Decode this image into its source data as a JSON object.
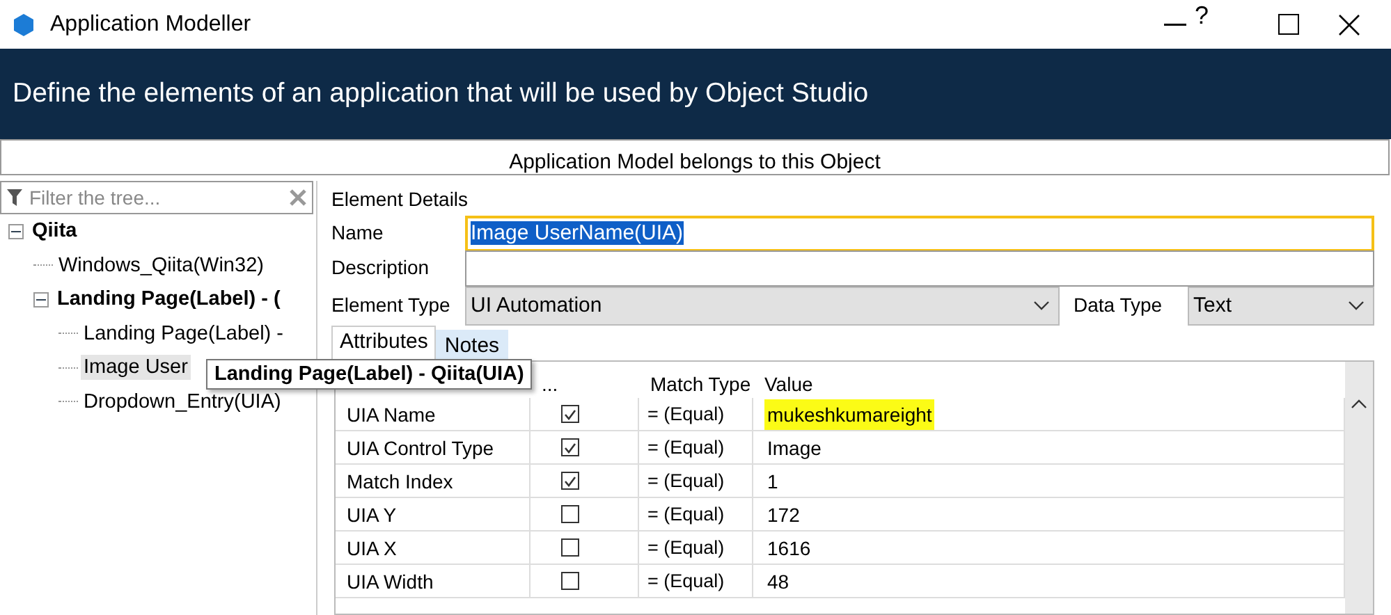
{
  "window": {
    "title": "Application Modeller",
    "help": "?"
  },
  "banner": "Define the elements of an application that will be used by Object Studio",
  "subtitle": "Application Model belongs to this Object",
  "tree": {
    "filter_placeholder": "Filter the tree...",
    "items": [
      {
        "label": "Qiita",
        "bold": true,
        "expanded": true,
        "selected": false,
        "children": [
          {
            "label": "Windows_Qiita(Win32)",
            "bold": false,
            "selected": false
          },
          {
            "label": "Landing Page(Label) - (",
            "bold": true,
            "expanded": true,
            "selected": false,
            "children": [
              {
                "label": "Landing Page(Label) -",
                "bold": false,
                "selected": false
              },
              {
                "label": "Image User",
                "bold": false,
                "selected": true
              },
              {
                "label": "Dropdown_Entry(UIA)",
                "bold": false,
                "selected": false
              }
            ]
          }
        ]
      }
    ]
  },
  "tooltip": "Landing Page(Label) - Qiita(UIA)",
  "details": {
    "heading": "Element Details",
    "name_label": "Name",
    "name_value": "Image UserName(UIA)",
    "description_label": "Description",
    "type_label": "Element Type",
    "type_value": "UI Automation",
    "data_type_label": "Data Type",
    "data_type_value": "Text"
  },
  "tabs": [
    {
      "label": "Attributes",
      "selected": true
    },
    {
      "label": "Notes",
      "selected": false
    }
  ],
  "table": {
    "columns": [
      "...",
      "Match Type",
      "Value"
    ],
    "rows": [
      {
        "name": "UIA Name",
        "checked": true,
        "match": "=  (Equal)",
        "value": "mukeshkumareight",
        "highlighted": true
      },
      {
        "name": "UIA Control Type",
        "checked": true,
        "match": "=  (Equal)",
        "value": "Image",
        "highlighted": false
      },
      {
        "name": "Match Index",
        "checked": true,
        "match": "=  (Equal)",
        "value": "1",
        "highlighted": false
      },
      {
        "name": "UIA Y",
        "checked": false,
        "match": "=  (Equal)",
        "value": "172",
        "highlighted": false
      },
      {
        "name": "UIA X",
        "checked": false,
        "match": "=  (Equal)",
        "value": "1616",
        "highlighted": false
      },
      {
        "name": "UIA Width",
        "checked": false,
        "match": "=  (Equal)",
        "value": "48",
        "highlighted": false
      }
    ]
  }
}
